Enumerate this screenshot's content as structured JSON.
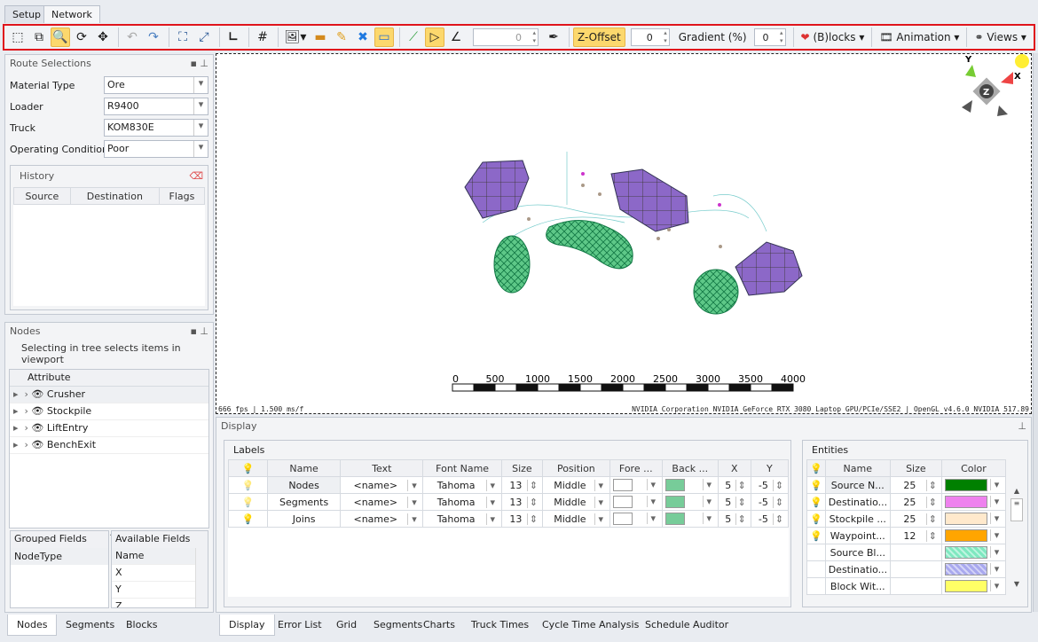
{
  "top_tabs": [
    "Setup",
    "Network"
  ],
  "toolbar": {
    "numeric_value": "0",
    "z_offset_label": "Z-Offset",
    "z_offset_value": "0",
    "gradient_label": "Gradient (%)",
    "gradient_value": "0",
    "blocks_label": "(B)locks",
    "animation_label": "Animation",
    "views_label": "Views"
  },
  "route": {
    "title": "Route Selections",
    "fields": [
      {
        "label": "Material Type",
        "value": "Ore"
      },
      {
        "label": "Loader",
        "value": "R9400"
      },
      {
        "label": "Truck",
        "value": "KOM830E"
      },
      {
        "label": "Operating Conditions",
        "value": "Poor"
      }
    ]
  },
  "history": {
    "title": "History",
    "columns": [
      "Source",
      "Destination",
      "Flags"
    ]
  },
  "nodes": {
    "title": "Nodes",
    "hint": "Selecting in tree selects items in viewport",
    "column": "Attribute",
    "items": [
      "Crusher",
      "Stockpile",
      "LiftEntry",
      "BenchExit"
    ]
  },
  "grouped": {
    "title": "Grouped Fields",
    "items": [
      "NodeType"
    ]
  },
  "available": {
    "title": "Available Fields",
    "items": [
      "Name",
      "X",
      "Y",
      "Z"
    ]
  },
  "left_tabs": [
    "Nodes",
    "Segments",
    "Blocks"
  ],
  "viewport": {
    "fps": "666 fps | 1.500 ms/f",
    "gpu": "NVIDIA Corporation NVIDIA GeForce RTX 3080 Laptop GPU/PCIe/SSE2 | OpenGL v4.6.0 NVIDIA 517.89",
    "scale_labels": [
      "0",
      "500",
      "1000",
      "1500",
      "2000",
      "2500",
      "3000",
      "3500",
      "4000"
    ],
    "axes": {
      "x": "X",
      "y": "Y",
      "z": "Z"
    }
  },
  "display": {
    "title": "Display",
    "labels_title": "Labels",
    "label_columns": [
      "Name",
      "Text",
      "Font Name",
      "Size",
      "Position",
      "Fore ...",
      "Back ...",
      "X",
      "Y"
    ],
    "label_rows": [
      {
        "name": "Nodes",
        "text": "<name>",
        "font": "Tahoma",
        "size": "13",
        "position": "Middle",
        "x": "5",
        "y": "-5"
      },
      {
        "name": "Segments",
        "text": "<name>",
        "font": "Tahoma",
        "size": "13",
        "position": "Middle",
        "x": "5",
        "y": "-5"
      },
      {
        "name": "Joins",
        "text": "<name>",
        "font": "Tahoma",
        "size": "13",
        "position": "Middle",
        "x": "5",
        "y": "-5"
      }
    ],
    "entities_title": "Entities",
    "entity_columns": [
      "Name",
      "Size",
      "Color"
    ],
    "entity_rows": [
      {
        "name": "Source N...",
        "size": "25",
        "color": "#008000",
        "bulb": true
      },
      {
        "name": "Destinatio...",
        "size": "25",
        "color": "#ee82ee",
        "bulb": true
      },
      {
        "name": "Stockpile ...",
        "size": "25",
        "color": "#ffe9cc",
        "bulb": true
      },
      {
        "name": "Waypoint...",
        "size": "12",
        "color": "#ffa500",
        "bulb": true
      },
      {
        "name": "Source Bl...",
        "size": "",
        "color": "#7fe8c0",
        "bulb": false
      },
      {
        "name": "Destinatio...",
        "size": "",
        "color": "#a9a9ee",
        "bulb": false
      },
      {
        "name": "Block Wit...",
        "size": "",
        "color": "#ffff66",
        "bulb": false
      }
    ]
  },
  "bottom_tabs": [
    "Display",
    "Error List",
    "Grid",
    "Segments",
    "Charts",
    "Truck Times",
    "Cycle Time Analysis",
    "Schedule Auditor"
  ]
}
